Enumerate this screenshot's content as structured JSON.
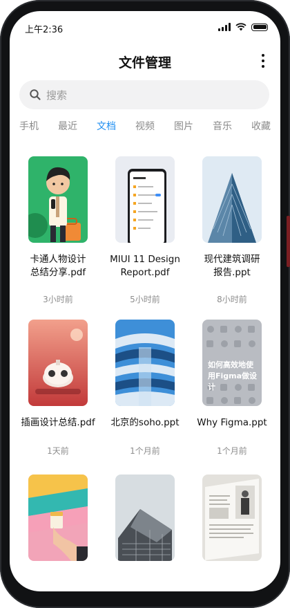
{
  "status_bar": {
    "time": "上午2:36"
  },
  "header": {
    "title": "文件管理"
  },
  "search": {
    "placeholder": "搜索"
  },
  "tabs": [
    "手机",
    "最近",
    "文档",
    "视频",
    "图片",
    "音乐",
    "收藏"
  ],
  "active_tab": "文档",
  "files": [
    {
      "name_line1": "卡通人物设计",
      "name_line2": "总结分享.pdf",
      "time": "3小时前",
      "thumb": "cartoon-figure"
    },
    {
      "name_line1": "MIUI 11 Design",
      "name_line2": "Report.pdf",
      "time": "5小时前",
      "thumb": "phone-mockup"
    },
    {
      "name_line1": "现代建筑调研",
      "name_line2": "报告.ppt",
      "time": "8小时前",
      "thumb": "glass-building"
    },
    {
      "name_line1": "插画设计总结.pdf",
      "name_line2": "",
      "time": "1天前",
      "thumb": "robot-illustration"
    },
    {
      "name_line1": "北京的soho.ppt",
      "name_line2": "",
      "time": "1个月前",
      "thumb": "soho-building"
    },
    {
      "name_line1": "Why Figma.ppt",
      "name_line2": "",
      "time": "1个月前",
      "thumb": "figma-icons",
      "thumb_text": "如何高效地使用Figma做设计"
    },
    {
      "name_line1": "",
      "name_line2": "",
      "time": "",
      "thumb": "coffee-hand"
    },
    {
      "name_line1": "",
      "name_line2": "",
      "time": "",
      "thumb": "grey-architecture"
    },
    {
      "name_line1": "",
      "name_line2": "",
      "time": "",
      "thumb": "magazine-spread"
    }
  ],
  "colors": {
    "accent": "#1e8ef1",
    "muted_text": "#8d8d8d",
    "search_bg": "#f2f2f3"
  },
  "icons": [
    "signal-icon",
    "wifi-icon",
    "battery-icon",
    "more-icon",
    "search-icon"
  ]
}
